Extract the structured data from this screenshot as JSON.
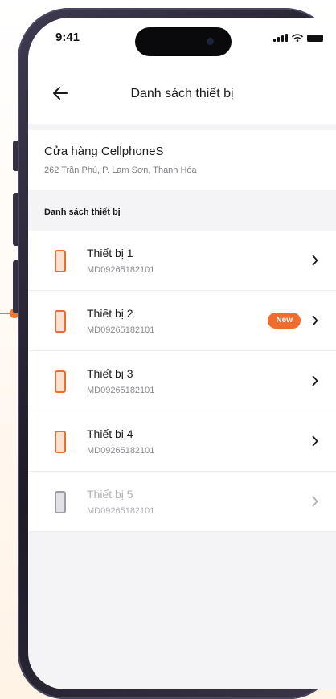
{
  "status_bar": {
    "time": "9:41"
  },
  "header": {
    "title": "Danh sách thiết bị",
    "back_icon": "arrow-left-icon"
  },
  "store": {
    "name": "Cửa hàng CellphoneS",
    "address": "262 Trần Phú, P. Lam Sơn, Thanh Hóa"
  },
  "section": {
    "label": "Danh sách thiết bị"
  },
  "devices": [
    {
      "name": "Thiết bị 1",
      "code": "MD09265182101",
      "badge": "",
      "enabled": true
    },
    {
      "name": "Thiết bị 2",
      "code": "MD09265182101",
      "badge": "New",
      "enabled": true
    },
    {
      "name": "Thiết bị 3",
      "code": "MD09265182101",
      "badge": "",
      "enabled": true
    },
    {
      "name": "Thiết bị 4",
      "code": "MD09265182101",
      "badge": "",
      "enabled": true
    },
    {
      "name": "Thiết bị 5",
      "code": "MD09265182101",
      "badge": "",
      "enabled": false
    }
  ],
  "colors": {
    "accent": "#ef6c2f",
    "disabled": "#b0b0b6",
    "screen_bg": "#f4f4f6"
  }
}
